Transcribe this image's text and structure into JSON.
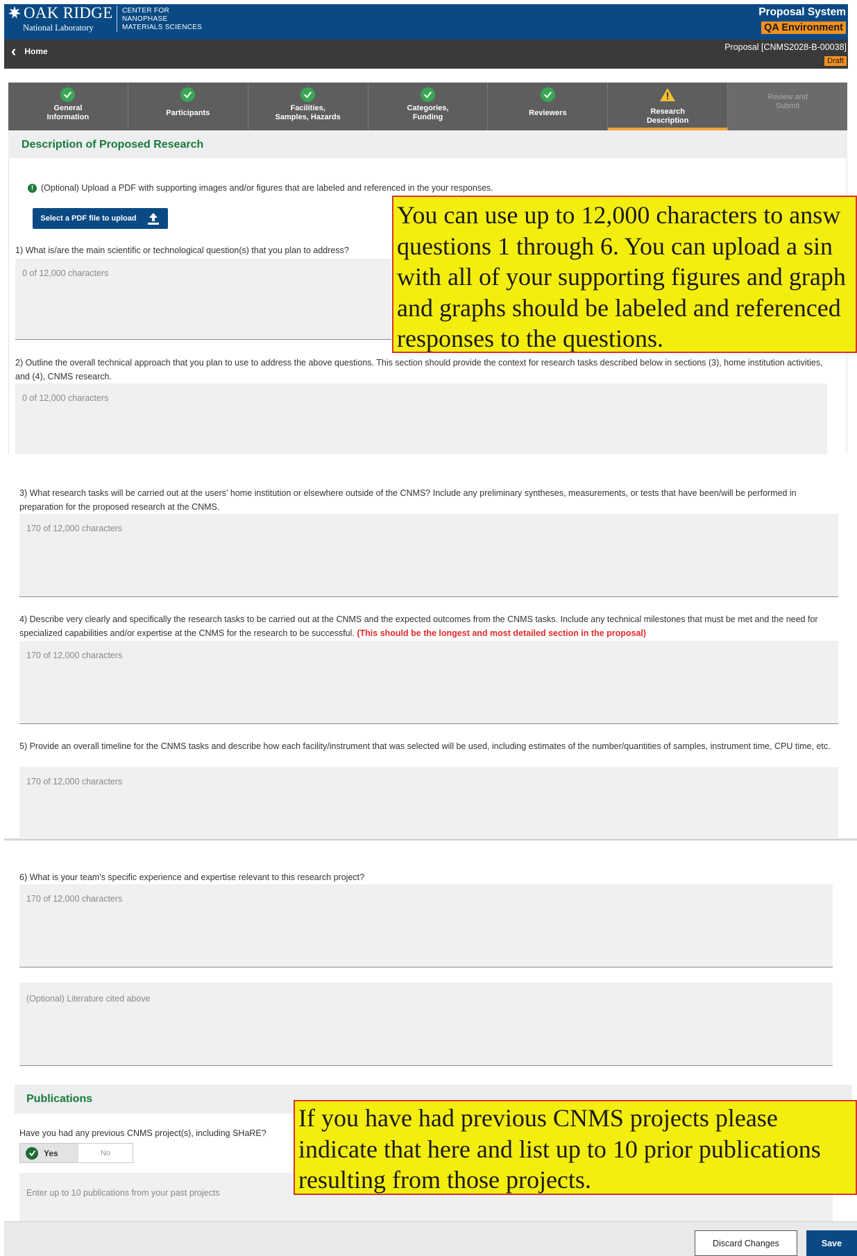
{
  "header": {
    "logo_main": "OAK RIDGE",
    "logo_sub": "National Laboratory",
    "logo_center_lines": [
      "CENTER FOR",
      "NANOPHASE",
      "MATERIALS SCIENCES"
    ],
    "system_title": "Proposal System",
    "environment": "QA Environment"
  },
  "nav": {
    "home_label": "Home",
    "proposal_id": "Proposal [CNMS2028-B-00038]",
    "status": "Draft"
  },
  "steps": [
    {
      "label": "General\nInformation",
      "state": "complete"
    },
    {
      "label": "Participants",
      "state": "complete"
    },
    {
      "label": "Facilities,\nSamples, Hazards",
      "state": "complete"
    },
    {
      "label": "Categories,\nFunding",
      "state": "complete"
    },
    {
      "label": "Reviewers",
      "state": "complete"
    },
    {
      "label": "Research\nDescription",
      "state": "warning"
    },
    {
      "label": "Review and\nSubmit",
      "state": "disabled"
    }
  ],
  "section": {
    "title": "Description of Proposed Research",
    "upload_note": "(Optional) Upload a PDF with supporting images and/or figures that are labeled and referenced in the your responses.",
    "upload_button": "Select a PDF file to upload"
  },
  "questions": {
    "q1": {
      "text": "1) What is/are the main scientific or technological question(s) that you plan to address?",
      "counter": "0 of 12,000 characters"
    },
    "q2": {
      "text": "2) Outline the overall technical approach that you plan to use to address the above questions. This section should provide the context for research tasks described below in sections (3), home institution activities, and (4), CNMS research.",
      "counter": "0 of 12,000 characters"
    },
    "q3": {
      "text": "3) What research tasks will be carried out at the users' home institution or elsewhere outside of the CNMS? Include any preliminary syntheses, measurements, or tests that have been/will be performed in preparation for the proposed research at the CNMS.",
      "counter": "170 of 12,000 characters"
    },
    "q4": {
      "text": "4) Describe very clearly and specifically the research tasks to be carried out at the CNMS and the expected outcomes from the CNMS tasks. Include any technical milestones that must be met and the need for specialized capabilities and/or expertise at the CNMS for the research to be successful. ",
      "note": "(This should be the longest and most detailed section in the proposal)",
      "counter": "170 of 12,000 characters"
    },
    "q5": {
      "text": "5) Provide an overall timeline for the CNMS tasks and describe how each facility/instrument that was selected will be used, including estimates of the number/quantities of samples, instrument time, CPU time, etc.",
      "counter": "170 of 12,000 characters"
    },
    "q6": {
      "text": "6) What is your team's specific experience and expertise relevant to this research project?",
      "counter": "170 of 12,000 characters"
    },
    "literature_placeholder": "(Optional) Literature cited above"
  },
  "callouts": {
    "top": [
      "You can use up to 12,000 characters to answ",
      "questions 1 through 6.  You can upload a sin",
      "with all of your supporting figures and graph",
      "and graphs should be labeled and referenced",
      "responses to the questions."
    ],
    "bottom": [
      "If you have had previous CNMS projects please",
      "indicate that here and list up to 10 prior publications",
      "resulting from those projects."
    ]
  },
  "publications": {
    "title": "Publications",
    "question": "Have you had any previous CNMS project(s), including SHaRE?",
    "yes": "Yes",
    "no": "No",
    "selected": "Yes",
    "placeholder": "Enter up to 10 publications from your past projects"
  },
  "footer": {
    "discard": "Discard Changes",
    "save": "Save"
  },
  "colors": {
    "header_blue": "#0a4a84",
    "accent_orange": "#f39120",
    "section_green": "#1a7a3a",
    "callout_yellow": "#f4ee0f",
    "callout_border": "#d6342e"
  }
}
